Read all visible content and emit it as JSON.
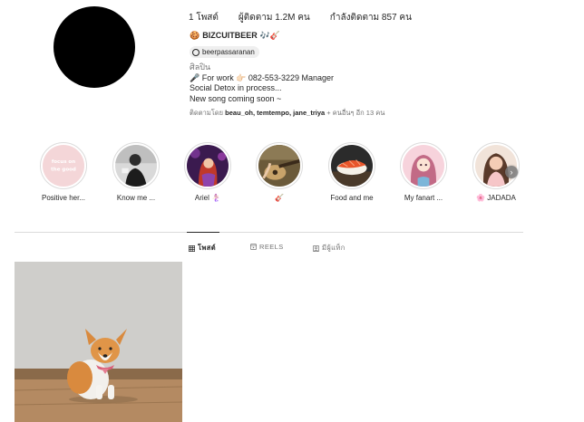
{
  "profile": {
    "posts_label": "1 โพสต์",
    "followers_label": "ผู้ติดตาม 1.2M คน",
    "following_label": "กำลังติดตาม 857 คน",
    "handle": "BIZCUITBEER",
    "handle_emoji_before": "🍪",
    "handle_emoji_after": "🎶🎸",
    "threads_username": "beerpassaranan",
    "bio_category": "ศิลปิน",
    "bio_lines": [
      "🎤 For work 👉🏻 082-553-3229 Manager",
      "Social Detox in process...",
      "New song coming soon ~"
    ],
    "followed_by_prefix": "ติดตามโดย",
    "followed_by_users": "beau_oh, temtempo, jane_triya",
    "followed_by_suffix": "+ คนอื่นๆ อีก 13 คน"
  },
  "highlights": [
    {
      "label": "Positive her...",
      "icon": "focus-on-the-good-cover",
      "cover_text": "focus on the good"
    },
    {
      "label": "Know me ...",
      "icon": "portrait-cover"
    },
    {
      "label": "Ariel 🧜🏻‍♀️",
      "icon": "mermaid-cover"
    },
    {
      "label": "🎸",
      "icon": "guitar-cover"
    },
    {
      "label": "Food and me",
      "icon": "sushi-cover"
    },
    {
      "label": "My fanart ...",
      "icon": "fanart-cover"
    },
    {
      "label": "🌸 JADADA",
      "icon": "portrait-cover"
    }
  ],
  "tabs": [
    {
      "label": "โพสต์",
      "icon": "grid-icon",
      "active": true
    },
    {
      "label": "REELS",
      "icon": "reels-icon",
      "active": false
    },
    {
      "label": "มีผู้แท็ก",
      "icon": "tagged-icon",
      "active": false
    }
  ],
  "posts": [
    {
      "icon": "corgi-photo"
    }
  ],
  "colors": {
    "text": "#262626",
    "muted": "#737373",
    "border": "#dbdbdb",
    "chip_bg": "#efefef"
  }
}
